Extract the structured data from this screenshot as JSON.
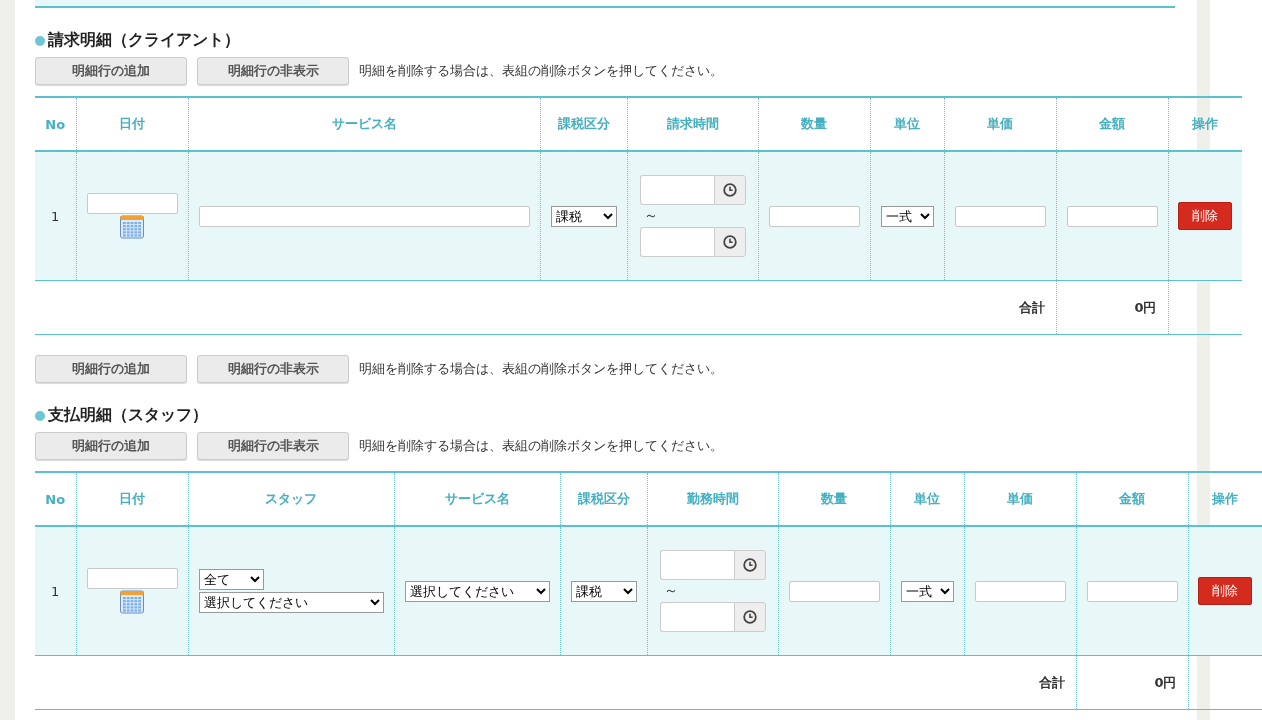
{
  "sections": [
    {
      "title": "請求明細（クライアント）",
      "toolbar": {
        "buttons": [
          "明細行の追加",
          "明細行の非表示"
        ],
        "note": "明細を削除する場合は、表組の削除ボタンを押してください。"
      },
      "table": {
        "columns": [
          "No",
          "日付",
          "サービス名",
          "課税区分",
          "請求時間",
          "数量",
          "単位",
          "単価",
          "金額",
          "操作"
        ],
        "rows": [
          {
            "cells": [
              {
                "kind": "text",
                "value": "1"
              },
              {
                "kind": "date"
              },
              {
                "kind": "input"
              },
              {
                "kind": "select",
                "value": "課税"
              },
              {
                "kind": "time_range",
                "separator": "～"
              },
              {
                "kind": "input"
              },
              {
                "kind": "select",
                "value": "一式"
              },
              {
                "kind": "input"
              },
              {
                "kind": "input"
              },
              {
                "kind": "delete",
                "label": "削除"
              }
            ]
          }
        ],
        "total_label": "合計",
        "total_value": "0円"
      },
      "footer_toolbar": {
        "buttons": [
          "明細行の追加",
          "明細行の非表示"
        ],
        "note": "明細を削除する場合は、表組の削除ボタンを押してください。"
      }
    },
    {
      "title": "支払明細（スタッフ）",
      "toolbar": {
        "buttons": [
          "明細行の追加",
          "明細行の非表示"
        ],
        "note": "明細を削除する場合は、表組の削除ボタンを押してください。"
      },
      "table": {
        "columns": [
          "No",
          "日付",
          "スタッフ",
          "サービス名",
          "課税区分",
          "勤務時間",
          "数量",
          "単位",
          "単価",
          "金額",
          "操作"
        ],
        "rows": [
          {
            "cells": [
              {
                "kind": "text",
                "value": "1"
              },
              {
                "kind": "date"
              },
              {
                "kind": "selects",
                "values": [
                  "全て",
                  "選択してください"
                ]
              },
              {
                "kind": "select",
                "value": "選択してください"
              },
              {
                "kind": "select",
                "value": "課税"
              },
              {
                "kind": "time_range",
                "separator": "～"
              },
              {
                "kind": "input"
              },
              {
                "kind": "select",
                "value": "一式"
              },
              {
                "kind": "input"
              },
              {
                "kind": "input"
              },
              {
                "kind": "delete",
                "label": "削除"
              }
            ]
          }
        ],
        "total_label": "合計",
        "total_value": "0円"
      }
    }
  ]
}
